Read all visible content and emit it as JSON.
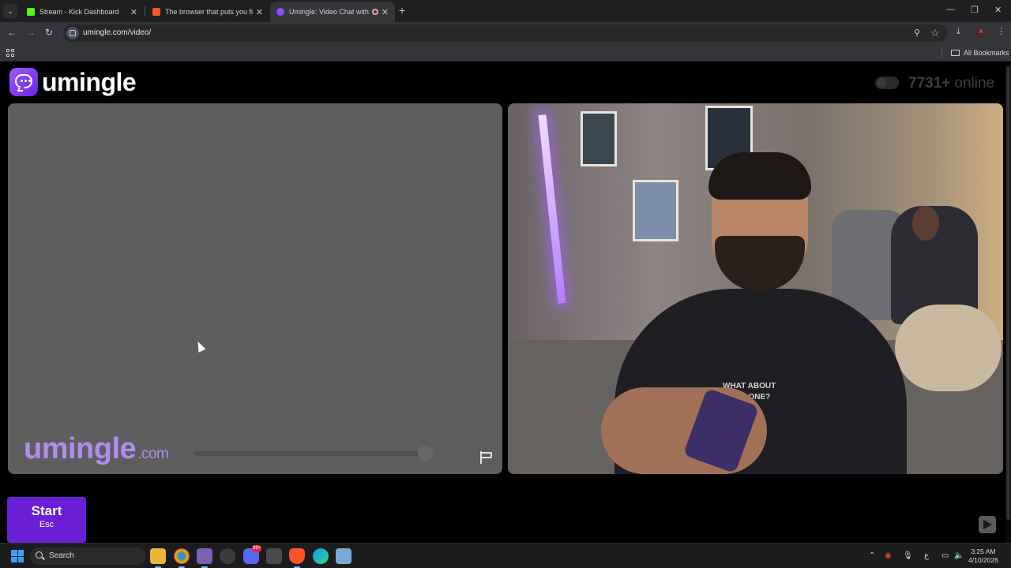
{
  "browser": {
    "tabs": [
      {
        "title": "Stream - Kick Dashboard",
        "favicon_color": "#53fc18"
      },
      {
        "title": "The browser that puts you first",
        "favicon_color": "#fb542b"
      },
      {
        "title": "Umingle: Video Chat with Stra",
        "favicon_color": "#8a4dff"
      }
    ],
    "active_tab": 2,
    "url": "umingle.com/video/",
    "bookmarks_label": "All Bookmarks",
    "profile_initial": "A"
  },
  "page": {
    "logo_text": "umingle",
    "online_count": "7731+",
    "online_label": "online",
    "watermark_main": "umingle",
    "watermark_suffix": ".com",
    "shirt_line1": "WHAT ABOUT",
    "shirt_line2": "THIS ONE?",
    "start_label": "Start",
    "start_shortcut": "Esc"
  },
  "taskbar": {
    "search_label": "Search",
    "discord_badge": "99+",
    "time": "3:25 AM",
    "date": "4/10/2026"
  },
  "colors": {
    "accent": "#6a1fd6",
    "watermark": "#b18cf0",
    "panel_empty": "#5e5e5e"
  }
}
